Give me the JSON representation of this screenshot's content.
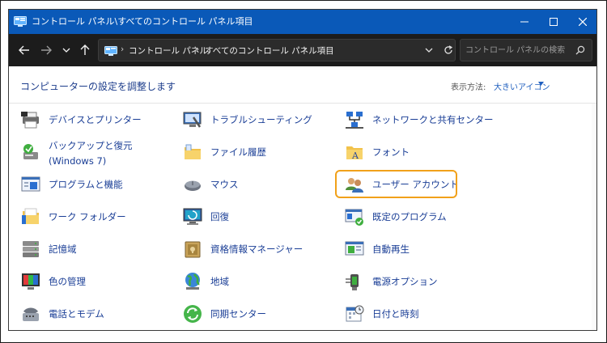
{
  "window": {
    "title": "コントロール パネル\\すべてのコントロール パネル項目"
  },
  "address": {
    "crumbs": [
      "コントロール パネル",
      "すべてのコントロール パネル項目"
    ],
    "search_placeholder": "コントロール パネルの検索"
  },
  "header": {
    "title": "コンピューターの設定を調整します",
    "view_label": "表示方法:",
    "view_value": "大きいアイコン"
  },
  "items": [
    {
      "label": "デバイスとプリンター",
      "icon": "printer-icon"
    },
    {
      "label": "トラブルシューティング",
      "icon": "troubleshoot-monitor-icon"
    },
    {
      "label": "ネットワークと共有センター",
      "icon": "network-icon"
    },
    {
      "label": "バックアップと復元 (Windows 7)",
      "icon": "backup-restore-icon"
    },
    {
      "label": "ファイル履歴",
      "icon": "file-history-folder-icon"
    },
    {
      "label": "フォント",
      "icon": "fonts-folder-icon"
    },
    {
      "label": "プログラムと機能",
      "icon": "programs-features-icon"
    },
    {
      "label": "マウス",
      "icon": "mouse-icon"
    },
    {
      "label": "ユーザー アカウント",
      "icon": "user-accounts-icon"
    },
    {
      "label": "ワーク フォルダー",
      "icon": "work-folders-icon"
    },
    {
      "label": "回復",
      "icon": "recovery-monitor-icon"
    },
    {
      "label": "既定のプログラム",
      "icon": "default-programs-icon"
    },
    {
      "label": "記憶域",
      "icon": "storage-spaces-icon"
    },
    {
      "label": "資格情報マネージャー",
      "icon": "credential-manager-icon"
    },
    {
      "label": "自動再生",
      "icon": "autoplay-icon"
    },
    {
      "label": "色の管理",
      "icon": "color-management-icon"
    },
    {
      "label": "地域",
      "icon": "region-globe-icon"
    },
    {
      "label": "電源オプション",
      "icon": "power-options-icon"
    },
    {
      "label": "電話とモデム",
      "icon": "phone-modem-icon"
    },
    {
      "label": "同期センター",
      "icon": "sync-center-icon"
    },
    {
      "label": "日付と時刻",
      "icon": "date-time-icon"
    }
  ],
  "colors": {
    "titlebar": "#0a59b8",
    "navbar": "#1c1c1c",
    "link": "#1a3e96",
    "highlight": "#f1a11a"
  }
}
